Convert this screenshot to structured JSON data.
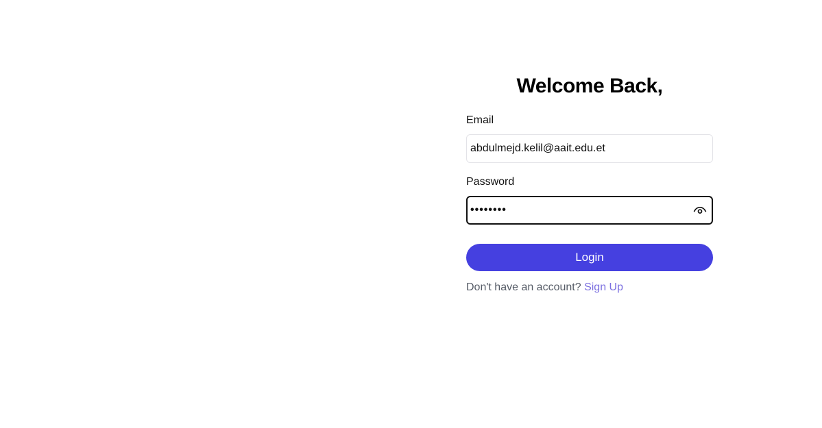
{
  "form": {
    "title": "Welcome Back,",
    "email": {
      "label": "Email",
      "value": "abdulmejd.kelil@aait.edu.et"
    },
    "password": {
      "label": "Password",
      "masked_value": "••••••••",
      "toggle_icon": "eye-icon"
    },
    "login_label": "Login",
    "signup_prompt": "Don't have an account?",
    "signup_link": "Sign Up"
  },
  "colors": {
    "accent": "#4540e0",
    "link": "#7b6fe0",
    "text": "#111111",
    "muted": "#555b66",
    "input_border": "#e3e3e8"
  }
}
